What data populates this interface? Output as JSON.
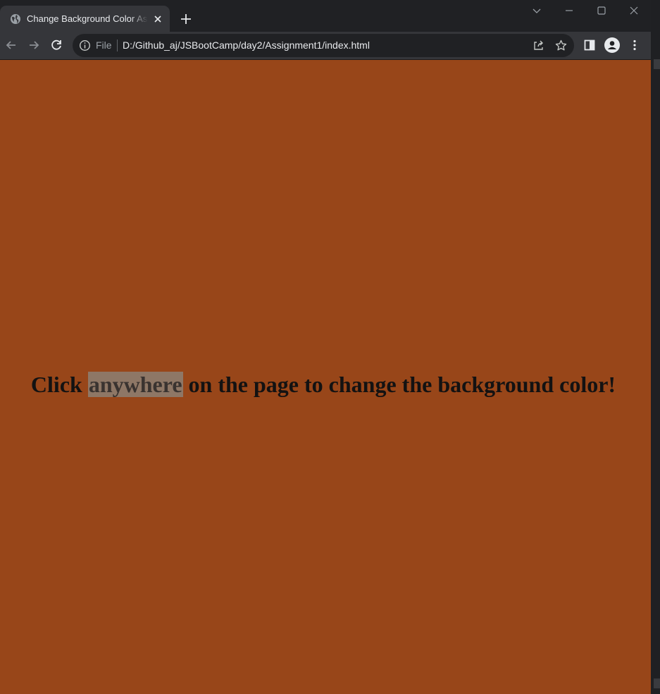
{
  "browser": {
    "tab_title": "Change Background Color Assignment",
    "new_tab_icon": "plus-icon",
    "window_controls": [
      "chevron-down-icon",
      "minimize-icon",
      "maximize-icon",
      "close-icon"
    ]
  },
  "toolbar": {
    "security_label": "File",
    "url": "D:/Github_aj/JSBootCamp/day2/Assignment1/index.html",
    "icons": [
      "back-icon",
      "forward-icon",
      "reload-icon",
      "info-icon",
      "share-icon",
      "star-icon",
      "sidepanel-icon",
      "profile-icon",
      "menu-icon"
    ]
  },
  "page": {
    "background_color": "#984619",
    "heading_before": "Click ",
    "heading_highlight": "anywhere",
    "heading_after": " on the page to change the background color!"
  },
  "colors": {
    "chrome_dark": "#202124",
    "chrome_toolbar": "#35363a",
    "text_light": "#e8eaed",
    "selection": "#8e7766"
  }
}
